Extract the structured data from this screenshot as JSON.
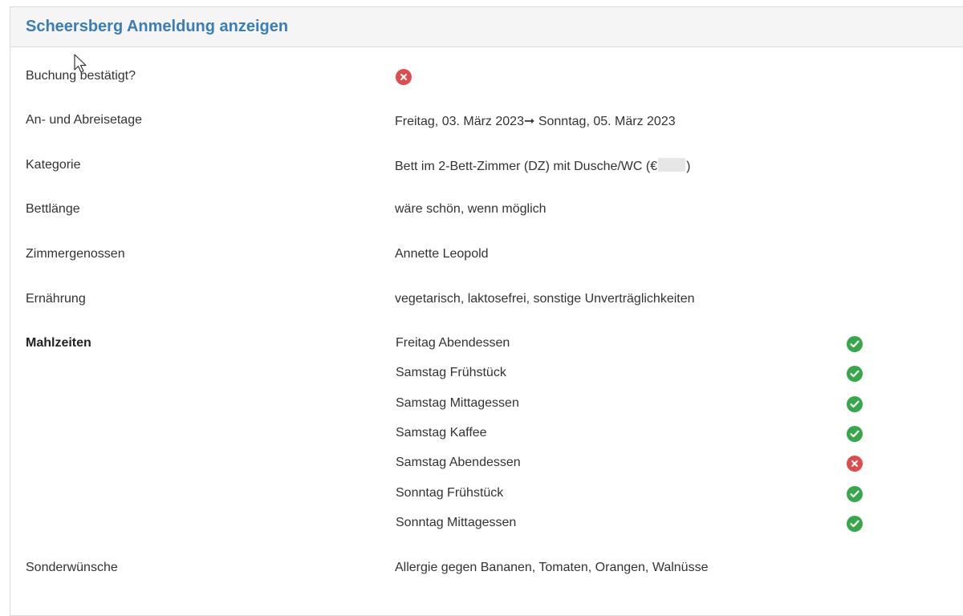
{
  "panel": {
    "title": "Scheersberg Anmeldung anzeigen"
  },
  "fields": {
    "confirmed": {
      "label": "Buchung bestätigt?",
      "status": "no"
    },
    "days": {
      "label": "An- und Abreisetage",
      "arrive": "Freitag, 03. März 2023",
      "arrow": "➞",
      "depart": "Sonntag, 05. März 2023"
    },
    "category": {
      "label": "Kategorie",
      "value_prefix": "Bett im 2-Bett-Zimmer (DZ) mit Dusche/WC (€",
      "value_suffix": ")"
    },
    "bed_length": {
      "label": "Bettlänge",
      "value": "wäre schön, wenn möglich"
    },
    "roommates": {
      "label": "Zimmergenossen",
      "value": "Annette Leopold"
    },
    "diet": {
      "label": "Ernährung",
      "value": "vegetarisch, laktosefrei, sonstige Unverträglichkeiten"
    },
    "meals": {
      "label": "Mahlzeiten",
      "items": [
        {
          "name": "Freitag Abendessen",
          "status": "yes"
        },
        {
          "name": "Samstag Frühstück",
          "status": "yes"
        },
        {
          "name": "Samstag Mittagessen",
          "status": "yes"
        },
        {
          "name": "Samstag Kaffee",
          "status": "yes"
        },
        {
          "name": "Samstag Abendessen",
          "status": "no"
        },
        {
          "name": "Sonntag Frühstück",
          "status": "yes"
        },
        {
          "name": "Sonntag Mittagessen",
          "status": "yes"
        }
      ]
    },
    "special": {
      "label": "Sonderwünsche",
      "value": "Allergie gegen Bananen, Tomaten, Orangen, Walnüsse"
    }
  },
  "colors": {
    "title": "#3a7db8",
    "yes": "#37a84a",
    "no": "#e04b4b"
  },
  "icons": {
    "yes": "check-circle-icon",
    "no": "x-circle-icon"
  }
}
